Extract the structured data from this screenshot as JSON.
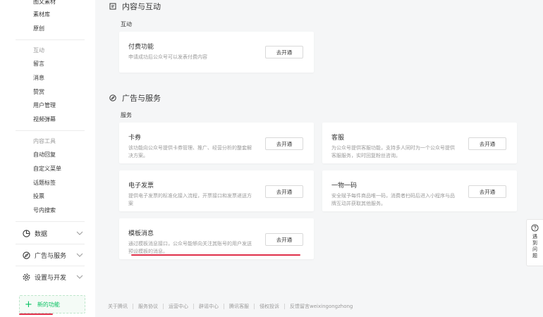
{
  "sidebar": {
    "top_items": [
      "图文素材",
      "素材库",
      "原创"
    ],
    "interaction": {
      "category": "互动",
      "items": [
        "留言",
        "消息",
        "赞赏",
        "用户管理",
        "视频弹幕"
      ]
    },
    "tools": {
      "category": "内容工具",
      "items": [
        "自动回复",
        "自定义菜单",
        "话题标签",
        "投票",
        "号内搜索"
      ]
    },
    "groups": [
      {
        "label": "数据",
        "icon": "chart-icon"
      },
      {
        "label": "广告与服务",
        "icon": "compass-icon"
      },
      {
        "label": "设置与开发",
        "icon": "gear-icon"
      }
    ],
    "new_feature": {
      "label": "新的功能",
      "icon": "plus-icon"
    }
  },
  "main": {
    "content_section": {
      "title": "内容与互动",
      "subtitle": "互动",
      "cards": [
        {
          "title": "付费功能",
          "desc": "申请成功后公众号可以发表付费内容",
          "button": "去开通"
        }
      ]
    },
    "ads_section": {
      "title": "广告与服务",
      "subtitle": "服务",
      "cards": [
        {
          "title": "卡券",
          "desc": "该功能向公众号提供卡券管理、推广、经营分析的整套解决方案。",
          "button": "去开通"
        },
        {
          "title": "客服",
          "desc": "为公众号提供客服功能，支持多人同时为一个公众号提供客服服务，实时回复粉丝咨询。",
          "button": "去开通"
        },
        {
          "title": "电子发票",
          "desc": "提供电子发票的标准化接入流程，开票接口和发票递送方案",
          "button": "去开通"
        },
        {
          "title": "一物一码",
          "desc": "安全赋予每件商品唯一码，消费者扫码后进入小程序与品牌互动并获取其他服务。",
          "button": "去开通"
        },
        {
          "title": "模板消息",
          "desc": "通过模板消息接口，公众号能够向关注其账号的用户发送预设模板的消息。",
          "button": "去开通"
        }
      ]
    }
  },
  "footer": {
    "links": [
      "关于腾讯",
      "服务协议",
      "运营中心",
      "辟谣中心",
      "腾讯客服",
      "侵权投诉",
      "反馈留言weixingongzhong"
    ]
  },
  "help": {
    "chars": [
      "遇",
      "到",
      "问",
      "题"
    ],
    "icon": "question-icon"
  },
  "colors": {
    "accent": "#07c160",
    "highlight": "#e0304a"
  }
}
